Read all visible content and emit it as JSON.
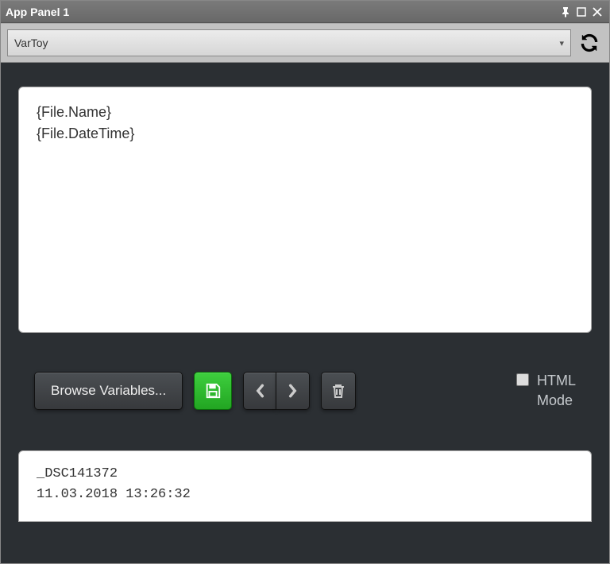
{
  "window": {
    "title": "App Panel 1"
  },
  "dropdown": {
    "selected": "VarToy"
  },
  "editor": {
    "content": "{File.Name}\n{File.DateTime}"
  },
  "toolbar": {
    "browse_label": "Browse Variables...",
    "html_mode_label": "HTML\nMode",
    "html_mode_checked": false
  },
  "output": {
    "filename": "_DSC141372",
    "datetime": "11.03.2018 13:26:32"
  },
  "colors": {
    "accent_green": "#2eb82e",
    "bg_dark": "#2b2f33"
  }
}
